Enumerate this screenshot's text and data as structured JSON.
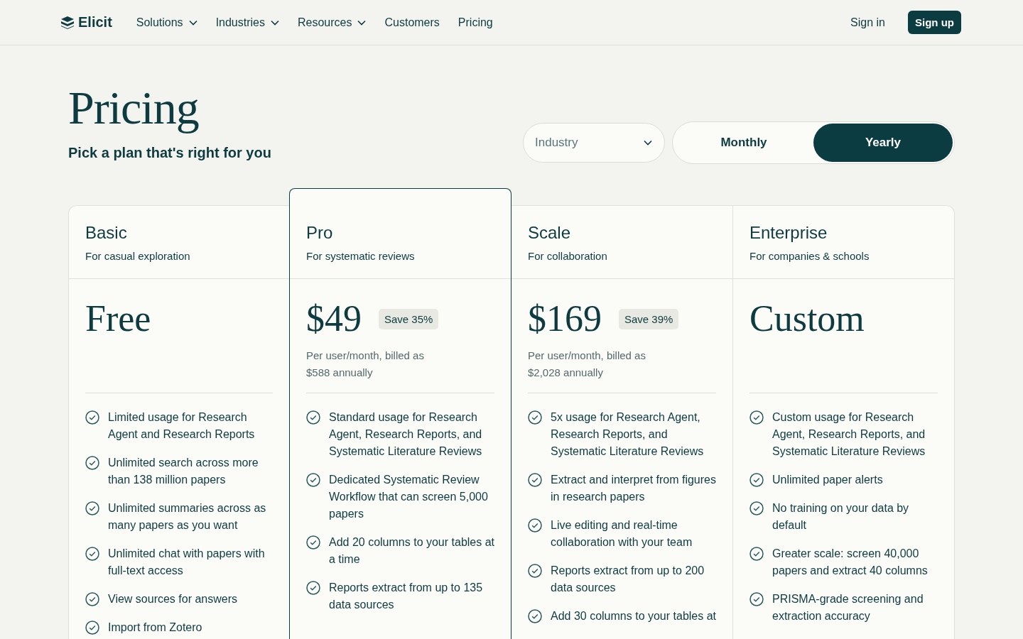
{
  "nav": {
    "brand": "Elicit",
    "links": [
      {
        "label": "Solutions",
        "dropdown": true
      },
      {
        "label": "Industries",
        "dropdown": true
      },
      {
        "label": "Resources",
        "dropdown": true
      },
      {
        "label": "Customers",
        "dropdown": false
      },
      {
        "label": "Pricing",
        "dropdown": false
      }
    ],
    "sign_in": "Sign in",
    "sign_up": "Sign up"
  },
  "hero": {
    "title": "Pricing",
    "subtitle": "Pick a plan that's right for you"
  },
  "industry_select": {
    "placeholder": "Industry"
  },
  "billing": [
    {
      "label": "Monthly",
      "selected": false
    },
    {
      "label": "Yearly",
      "selected": true
    }
  ],
  "plans": [
    {
      "name": "Basic",
      "tagline": "For casual exploration",
      "price": "Free",
      "featured": false,
      "features": [
        "Limited usage for Research Agent and Research Reports",
        "Unlimited search across more than 138 million papers",
        "Unlimited summaries across as many papers as you want",
        "Unlimited chat with papers with full-text access",
        "View sources for answers",
        "Import from Zotero"
      ]
    },
    {
      "name": "Pro",
      "tagline": "For systematic reviews",
      "price": "$49",
      "save": "Save 35%",
      "billing_note": "Per user/month, billed as $588 annually",
      "featured": true,
      "features": [
        "Standard usage for Research Agent, Research Reports, and Systematic Literature Reviews",
        "Dedicated Systematic Review Workflow that can screen 5,000 papers",
        "Add 20 columns to your tables at a time",
        "Reports extract from up to 135 data sources"
      ]
    },
    {
      "name": "Scale",
      "tagline": "For collaboration",
      "price": "$169",
      "save": "Save 39%",
      "billing_note": "Per user/month, billed as $2,028 annually",
      "featured": false,
      "features": [
        "5x usage for Research Agent, Research Reports, and Systematic Literature Reviews",
        "Extract and interpret from figures in research papers",
        "Live editing and real-time collaboration with your team",
        "Reports extract from up to 200 data sources",
        "Add 30 columns to your tables at"
      ]
    },
    {
      "name": "Enterprise",
      "tagline": "For companies & schools",
      "price": "Custom",
      "featured": false,
      "features": [
        "Custom usage for Research Agent, Research Reports, and Systematic Literature Reviews",
        "Unlimited paper alerts",
        "No training on your data by default",
        "Greater scale: screen 40,000 papers and extract 40 columns",
        "PRISMA-grade screening and extraction accuracy"
      ]
    }
  ]
}
